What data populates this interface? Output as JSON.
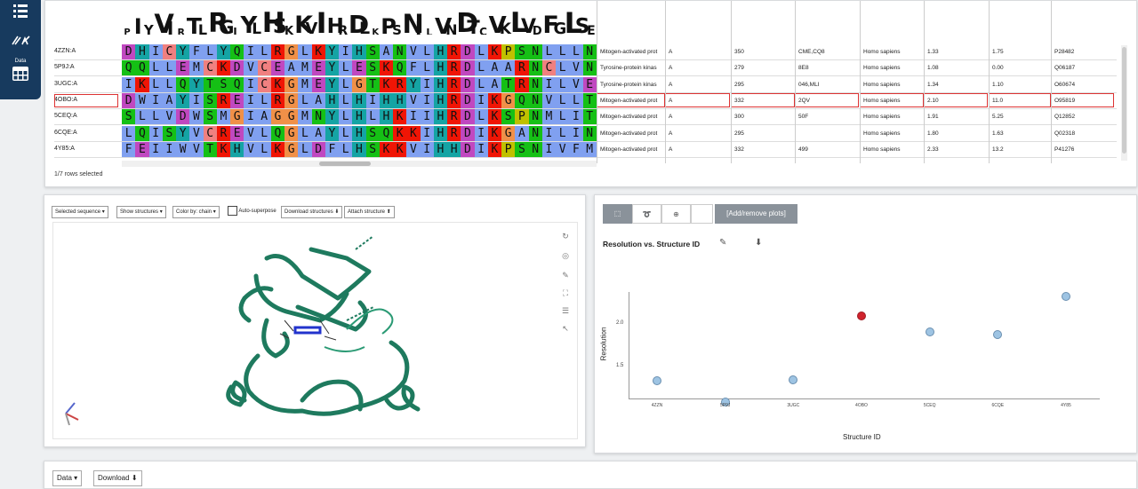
{
  "sidebar": {
    "top_icon": "list-icon",
    "tools_icon": "tools-icon",
    "data_label": "Data",
    "data_icon": "table-icon"
  },
  "msa": {
    "logo_letters": [
      "P",
      "I",
      "Y",
      "V",
      "I",
      "R",
      "T",
      "L",
      "R",
      "G",
      "I",
      "Y",
      "L",
      "H",
      "S",
      "K",
      "K",
      "V",
      "I",
      "H",
      "R",
      "D",
      "L",
      "K",
      "P",
      "S",
      "N",
      "I",
      "L",
      "V",
      "N",
      "D",
      "T",
      "C",
      "V",
      "K",
      "L",
      "V",
      "D",
      "F",
      "G",
      "L",
      "S",
      "E"
    ],
    "rows": [
      {
        "id": "4ZZN:A",
        "seq": "DHICYFLYQILRGLKYIHSANVLHRDLKPSNLLLNTTCDLKICDFGLA",
        "protein": "Mitogen-activated prot",
        "chain": "A",
        "length": "350",
        "ligand": "CME,CQ8",
        "organism": "Homo sapiens",
        "res": "1.33",
        "rfree": "1.75",
        "uniprot": "P28482"
      },
      {
        "id": "5P9J:A",
        "seq": "QQLLEMCKDVCEAMEYLESKQFLHRDLAARNCLVNDQGVVKVSDFGLS",
        "protein": "Tyrosine-protein kinas",
        "chain": "A",
        "length": "279",
        "ligand": "8E8",
        "organism": "Homo sapiens",
        "res": "1.08",
        "rfree": "0.00",
        "uniprot": "Q06187"
      },
      {
        "id": "3UGC:A",
        "seq": "IKLLQYTSQICKGMEYLGTKRYIHRDLATRNILVENENRVKIGDFGLT",
        "protein": "Tyrosine-protein kinas",
        "chain": "A",
        "length": "295",
        "ligand": "046,MLI",
        "organism": "Homo sapiens",
        "res": "1.34",
        "rfree": "1.10",
        "uniprot": "O60674"
      },
      {
        "id": "4OBO:A",
        "seq": "DWIAYISREILRGLAHLHIHHVIHRDIKGQNVLLTENAEVKLVDFGXXX",
        "protein": "Mitogen-activated prot",
        "chain": "A",
        "length": "332",
        "ligand": "2QV",
        "organism": "Homo sapiens",
        "res": "2.10",
        "rfree": "11.0",
        "uniprot": "O95819"
      },
      {
        "id": "5CEQ:A",
        "seq": "SLLVDWSMGIAGGMNYLHLHKIIHRDLKSPNMLITYDDVVKISDFGXXX",
        "protein": "Mitogen-activated prot",
        "chain": "A",
        "length": "300",
        "ligand": "50F",
        "organism": "Homo sapiens",
        "res": "1.91",
        "rfree": "5.25",
        "uniprot": "Q12852"
      },
      {
        "id": "6CQE:A",
        "seq": "LQISYVCREVLQGLAYLHSQKKIHRDIKGANILINDAGEVRLADFGIS",
        "protein": "Mitogen-activated prot",
        "chain": "A",
        "length": "295",
        "ligand": "",
        "organism": "Homo sapiens",
        "res": "1.80",
        "rfree": "1.63",
        "uniprot": "Q02318"
      },
      {
        "id": "4Y85:A",
        "seq": "FEIIWVTKHVLKGLDFLHSKKVIHHDIKPSNIVFMSTKAV-LVDFGLSV",
        "protein": "Mitogen-activated prot",
        "chain": "A",
        "length": "332",
        "ligand": "499",
        "organism": "Homo sapiens",
        "res": "2.33",
        "rfree": "13.2",
        "uniprot": "P41276"
      }
    ],
    "selected_row": 3,
    "status": "1/7 rows selected",
    "colors": {
      "A": "#80a0f0",
      "I": "#80a0f0",
      "L": "#80a0f0",
      "M": "#80a0f0",
      "F": "#80a0f0",
      "W": "#80a0f0",
      "V": "#80a0f0",
      "C": "#f08080",
      "K": "#f01505",
      "R": "#f01505",
      "E": "#c048c0",
      "D": "#c048c0",
      "N": "#15c015",
      "Q": "#15c015",
      "S": "#15c015",
      "T": "#15c015",
      "G": "#f09048",
      "P": "#c0c000",
      "H": "#15a4a4",
      "Y": "#15a4a4",
      "X": "#ffffff",
      "-": "#ffffff"
    }
  },
  "viewer": {
    "selected_sequence": "Selected sequence",
    "show_structures": "Show structures",
    "color_by": "Color by: chain",
    "auto_superpose": "Auto-superpose",
    "download_structures": "Download structures",
    "attach_structure": "Attach structure",
    "protein_color": "#1e7a5e"
  },
  "plot": {
    "add_remove": "[Add/remove plots]",
    "title": "Resolution vs. Structure ID",
    "xlabel": "Structure ID",
    "ylabel": "Resolution"
  },
  "chart_data": {
    "type": "scatter",
    "title": "Resolution vs. Structure ID",
    "xlabel": "Structure ID",
    "ylabel": "Resolution",
    "categories": [
      "4ZZN",
      "5P9J",
      "3UGC",
      "4OBO",
      "5CEQ",
      "6CQE",
      "4Y85"
    ],
    "values": [
      1.33,
      1.08,
      1.34,
      2.1,
      1.91,
      1.88,
      2.33
    ],
    "highlight_index": 3,
    "yticks": [
      1.5,
      2.0
    ],
    "ylim": [
      1.08,
      2.38
    ],
    "point_color": "#9ec4e3",
    "highlight_color": "#d0232d"
  },
  "bottom": {
    "data_label": "Data",
    "download_label": "Download"
  }
}
